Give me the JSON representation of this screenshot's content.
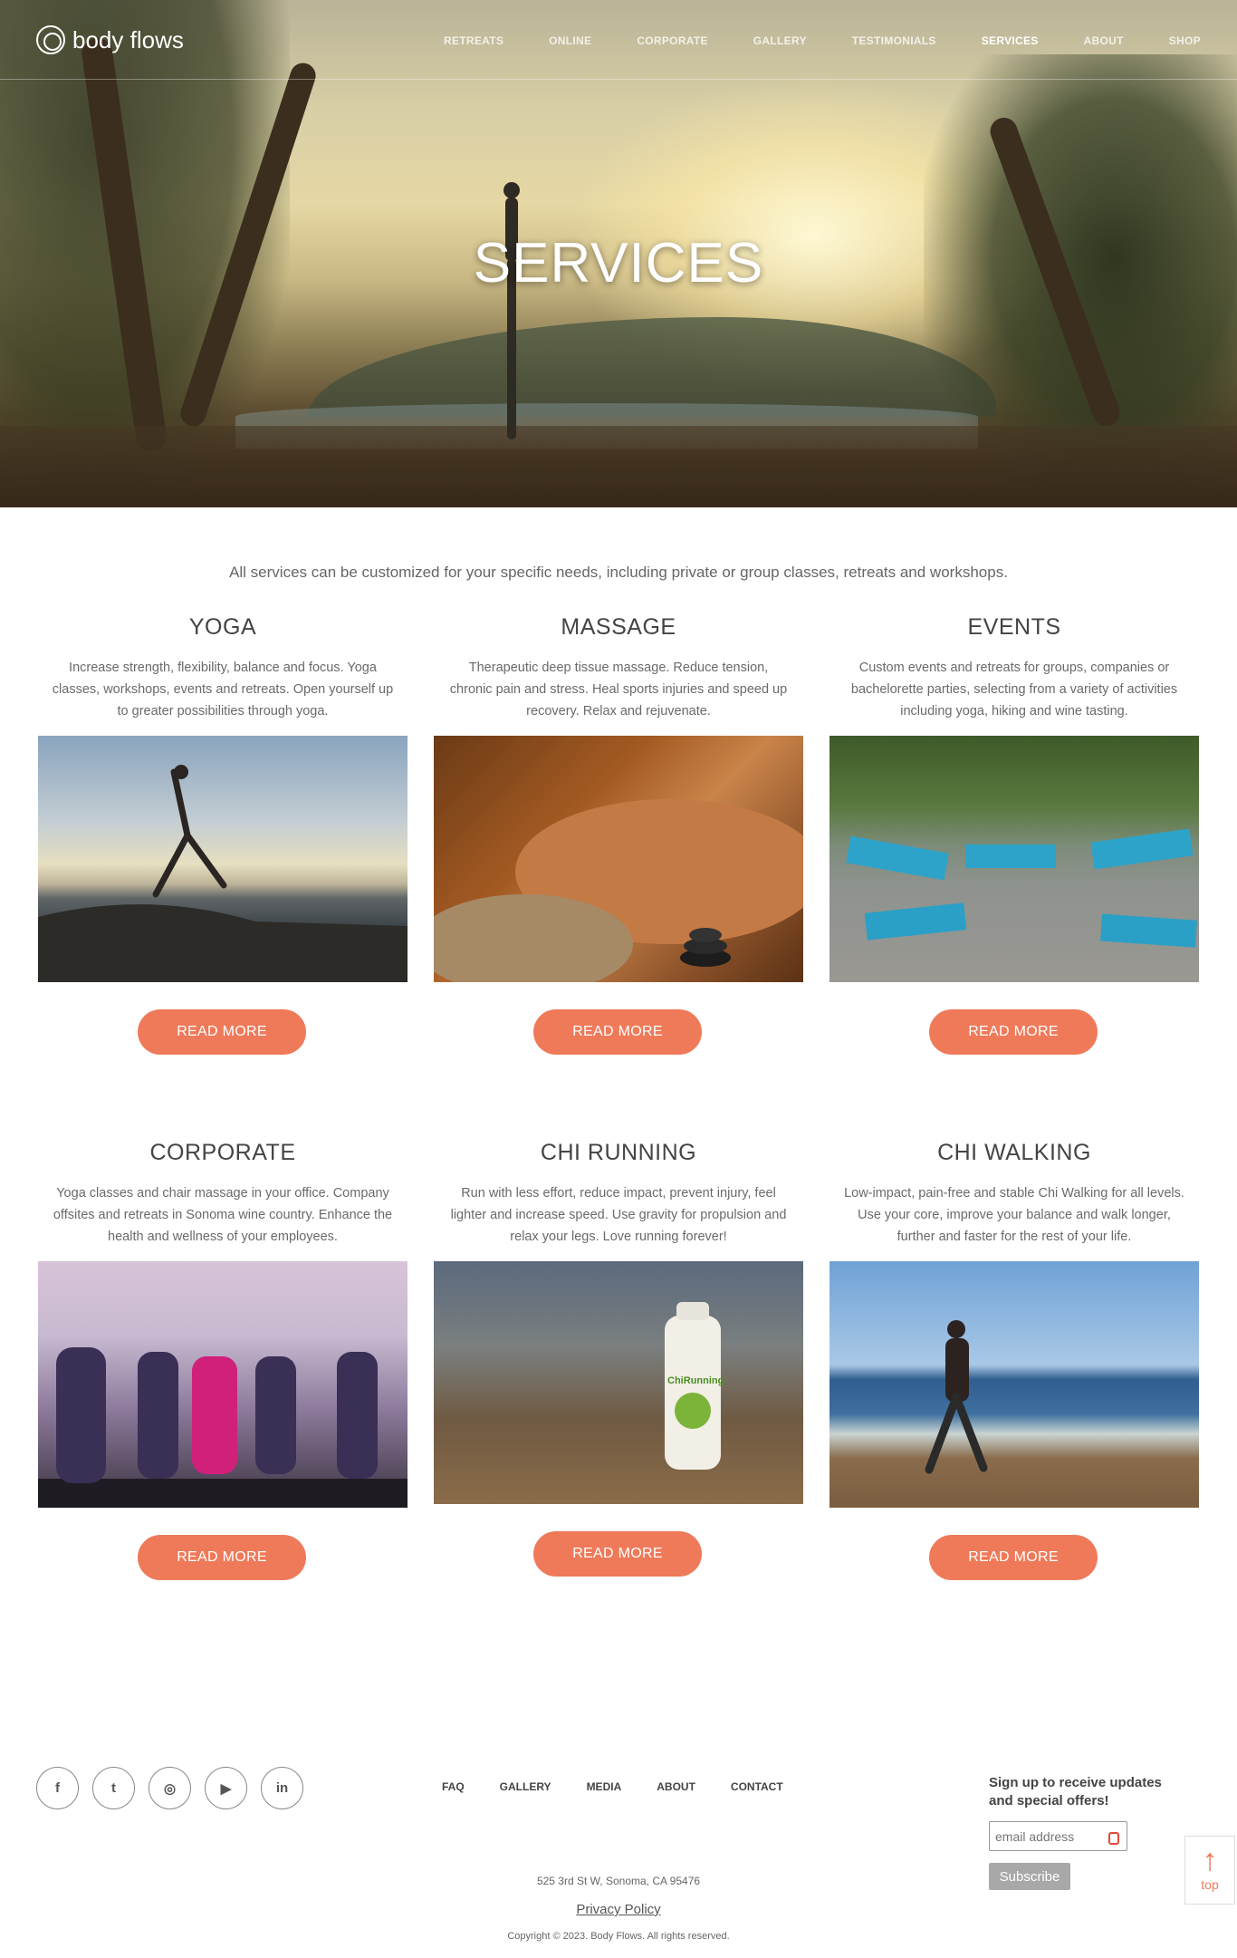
{
  "header": {
    "logo_text": "body flows",
    "nav": [
      {
        "label": "RETREATS"
      },
      {
        "label": "ONLINE"
      },
      {
        "label": "CORPORATE"
      },
      {
        "label": "GALLERY"
      },
      {
        "label": "TESTIMONIALS"
      },
      {
        "label": "SERVICES"
      },
      {
        "label": "ABOUT"
      },
      {
        "label": "SHOP"
      }
    ]
  },
  "hero": {
    "title": "SERVICES"
  },
  "intro": "All services can be customized for your specific needs, including private or group classes, retreats and workshops.",
  "services": [
    {
      "title": "YOGA",
      "description": "Increase strength, flexibility, balance and focus. Yoga classes, workshops, events and retreats. Open yourself up to greater possibilities through yoga.",
      "button": "READ MORE"
    },
    {
      "title": "MASSAGE",
      "description": "Therapeutic deep tissue massage. Reduce tension, chronic pain and stress. Heal sports injuries and speed up recovery. Relax and rejuvenate.",
      "button": "READ MORE"
    },
    {
      "title": "EVENTS",
      "description": "Custom events and retreats for groups, companies or bachelorette parties, selecting from a variety of activities including yoga, hiking and wine tasting.",
      "button": "READ MORE"
    },
    {
      "title": "CORPORATE",
      "description": "Yoga classes and chair massage in your office. Company offsites and retreats in Sonoma wine country. Enhance the health and wellness of your employees.",
      "button": "READ MORE"
    },
    {
      "title": "CHI RUNNING",
      "description": "Run with less effort, reduce impact, prevent injury, feel lighter and increase speed. Use gravity for propulsion and relax your legs. Love running forever!",
      "button": "READ MORE",
      "bottle_label": "ChiRunning"
    },
    {
      "title": "CHI WALKING",
      "description": "Low-impact, pain-free and stable Chi Walking for all levels. Use your core, improve your balance and walk longer, further and faster for the rest of your life.",
      "button": "READ MORE"
    }
  ],
  "footer": {
    "social": [
      {
        "icon": "facebook-icon",
        "glyph": "f"
      },
      {
        "icon": "twitter-icon",
        "glyph": "t"
      },
      {
        "icon": "instagram-icon",
        "glyph": "◎"
      },
      {
        "icon": "youtube-icon",
        "glyph": "▶"
      },
      {
        "icon": "linkedin-icon",
        "glyph": "in"
      }
    ],
    "links": [
      {
        "label": "FAQ"
      },
      {
        "label": "GALLERY"
      },
      {
        "label": "MEDIA"
      },
      {
        "label": "ABOUT"
      },
      {
        "label": "CONTACT"
      }
    ],
    "signup_text": "Sign up to receive updates and special offers!",
    "email_placeholder": "email address",
    "subscribe_label": "Subscribe",
    "address": "525 3rd St W, Sonoma, CA 95476",
    "privacy": "Privacy Policy",
    "copyright": "Copyright © 2023. Body Flows. All rights reserved.",
    "top_label": "top"
  },
  "colors": {
    "accent": "#ef7a5a",
    "text": "#555555"
  }
}
